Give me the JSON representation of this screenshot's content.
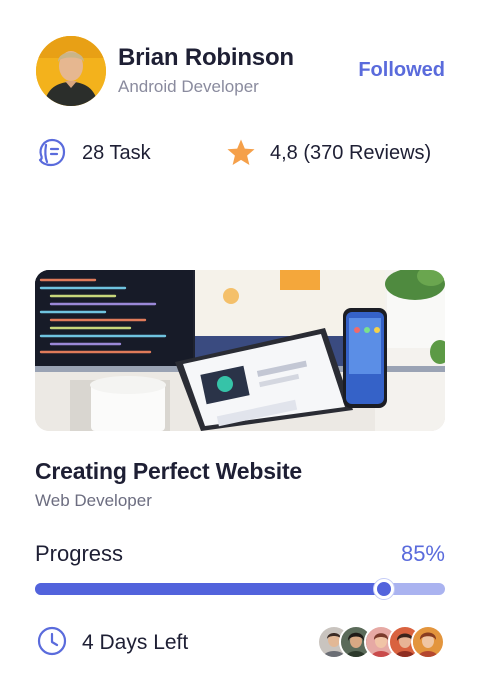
{
  "profile": {
    "name": "Brian Robinson",
    "role": "Android Developer",
    "follow_label": "Followed"
  },
  "stats": {
    "task_icon": "task-badge-icon",
    "task_label": "28 Task",
    "rating_icon": "star-icon",
    "rating_label": "4,8 (370 Reviews)"
  },
  "course": {
    "image": "workspace-devices-photo",
    "title": "Creating Perfect Website",
    "subtitle": "Web Developer"
  },
  "progress": {
    "label": "Progress",
    "value_label": "85%",
    "value": 0.85
  },
  "footer": {
    "clock_icon": "clock-icon",
    "days_left": "4 Days Left",
    "member_avatars": [
      "member-1",
      "member-2",
      "member-3",
      "member-4",
      "member-5"
    ]
  },
  "colors": {
    "accent": "#5a6bdc",
    "track": "#aab3f0",
    "star": "#f5a04a",
    "text": "#1e1f34",
    "muted": "#8a8b9e"
  }
}
